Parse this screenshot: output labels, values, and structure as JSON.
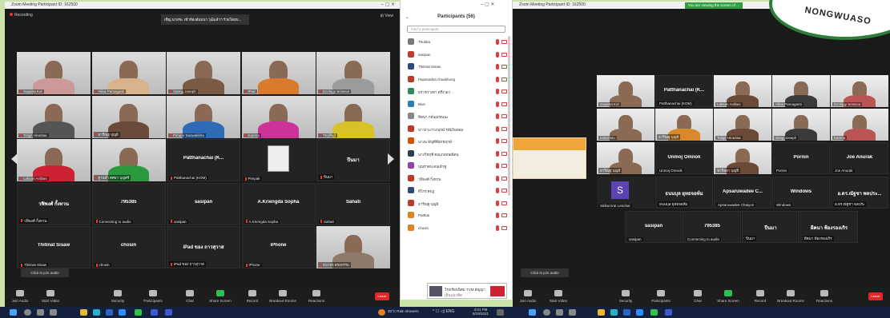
{
  "left_window": {
    "title": "Zoom Meeting Participant ID: 162500",
    "recording": "Recording",
    "view_label": "View",
    "banner": "เชิญ นายชะ เข้าห้องสัมมนา วุฒิแล้วฯ ร่วมโดยบ...",
    "tiles": [
      {
        "name": "Supatra Kol",
        "kind": "vid",
        "color": "#c99"
      },
      {
        "name": "Alina Pamaganti",
        "kind": "vid",
        "color": "#d7b28a"
      },
      {
        "name": "Saeng Joseph",
        "kind": "vid",
        "color": "#7a5a42"
      },
      {
        "name": "iPad",
        "kind": "vid",
        "color": "#d97b2a"
      },
      {
        "name": "Ecology Science",
        "kind": "vid",
        "color": "#9b9b9b"
      },
      {
        "name": "Taligit Hiranlaa",
        "kind": "vid",
        "color": "#555"
      },
      {
        "name": "ธาริณฐ บุญมี",
        "kind": "vid",
        "color": "#6a4a3a"
      },
      {
        "name": "Pimpor Saowakkha",
        "kind": "vid",
        "color": "#2e6bb5"
      },
      {
        "name": "Karima",
        "kind": "vid",
        "color": "#c39"
      },
      {
        "name": "Thylfhgf",
        "kind": "vid",
        "color": "#d9c227"
      },
      {
        "name": "Laksan Ardlani",
        "kind": "vid",
        "color": "#c23"
      },
      {
        "name": "ฐานสำ ศศธา บุญศรี",
        "kind": "vid",
        "color": "#2b9a3f"
      },
      {
        "name": "Patthanachai (K...",
        "kind": "name",
        "sub": "Patthanachai (KOM)"
      },
      {
        "name": "",
        "kind": "avatar",
        "sub": "Pimpak"
      },
      {
        "name": "ปีนมา",
        "kind": "name",
        "sub": "ปีนมา"
      },
      {
        "name": "วฟิพงศ์ กั้งทวน",
        "kind": "name",
        "sub": "วฟิพงศ์ กั้งทวน"
      },
      {
        "name": "795385",
        "kind": "name",
        "sub": "Connecting to audio"
      },
      {
        "name": "sasipan",
        "kind": "name",
        "sub": "sasipan"
      },
      {
        "name": "A.Kriengda Sopha",
        "kind": "name",
        "sub": "A.Kriengda Sopha"
      },
      {
        "name": "Sahati",
        "kind": "name",
        "sub": "Sahati"
      },
      {
        "name": "Thitinat Sisaw",
        "kind": "name",
        "sub": "Thitinat Sisaw"
      },
      {
        "name": "chosin",
        "kind": "name",
        "sub": "chosin"
      },
      {
        "name": "iPad ของ ถาวสุวาส",
        "kind": "name",
        "sub": "iPad ของ ถาวสุวาส"
      },
      {
        "name": "iPhone",
        "kind": "name",
        "sub": "iPhone"
      },
      {
        "name": "",
        "kind": "vid",
        "sub": "ธนาธร ตรงธรรม",
        "color": "#8c7a6a"
      }
    ],
    "join_audio": "Click to join audio",
    "toolbar": [
      "Join Audio",
      "Start Video",
      "Security",
      "Participants",
      "Chat",
      "Share Screen",
      "Record",
      "Breakout Rooms",
      "Reactions"
    ],
    "participants_count": "56",
    "end": "Leave"
  },
  "panel": {
    "title": "Participants (56)",
    "search_placeholder": "Find a participant",
    "rows": [
      {
        "name": "Thutiba",
        "color": "#7a7a7a"
      },
      {
        "name": "sasipan",
        "color": "#c0392b"
      },
      {
        "name": "Thitinat Sisaw",
        "color": "#2c4a7a"
      },
      {
        "name": "Papanadsa chuakhong",
        "color": "#c0392b"
      },
      {
        "name": "ธรวชว่างทา ตรึงวดา",
        "color": "#2e8b57"
      },
      {
        "name": "Bius",
        "color": "#2980b9"
      },
      {
        "name": "ทิตนา กลั่นณรณนะ",
        "color": "#7f8c8d"
      },
      {
        "name": "นาวงวะกาเงนุกษ์ รณีเงินทอม",
        "color": "#c0392b"
      },
      {
        "name": "นางน ทัญทีทีสุกชฤกษ์",
        "color": "#d35400"
      },
      {
        "name": "นางวีชฤชี คณุเกลกษณีตน",
        "color": "#2c3e50"
      },
      {
        "name": "บุณรวตน ตนเต้วซู",
        "color": "#8e44ad"
      },
      {
        "name": "วฟิพงศ์ กั้งทวน",
        "color": "#c0392b"
      },
      {
        "name": "ทิโกร ศกฏ",
        "color": "#2c4a7a"
      },
      {
        "name": "ธาริณฐ บุญมี",
        "color": "#c0392b"
      },
      {
        "name": "Patthai",
        "color": "#e67e22"
      },
      {
        "name": "chosin",
        "color": "#e67e22"
      }
    ]
  },
  "popup": {
    "text": "โรงเรียนนิคม TVM สัญญา",
    "sub": "เห็นแนวคิด"
  },
  "right_window": {
    "title": "Zoom Meeting Participant ID: 162500",
    "notice": "You are viewing the screen of ...",
    "tiles_row1": [
      "",
      "Patthanachai (K...",
      "",
      "",
      ""
    ],
    "tiles_row1_sub": [
      "Supatra Kol",
      "Patthanachai (KOM)",
      "Laksan Ardlani",
      "Alina Pamaganti",
      "Ecology Science"
    ],
    "tiles_row2_sub": [
      "Kokomsu",
      "ธาริณฐ บุญมี",
      "Taligit Hiranlaa",
      "Seng Joseph",
      "Karima"
    ],
    "tiles_row3": [
      "",
      "Unmoj Omnok",
      "",
      "Pornin",
      "Joe Anurak"
    ],
    "tiles_row3_sub": [
      "ธาริณฐ บุญมี",
      "Unmoj Omnok",
      "ชากิลยา บุญทิ",
      "Pornin",
      "Joe Anurak"
    ],
    "tiles_row4": [
      "S",
      "ธนนบุล ยุทธจอห์ม",
      "Apsaruwadee C...",
      "Windows",
      "อ.ดร.ณัฐชา พลประ..."
    ],
    "tiles_row4_sub": [
      "Sirikornrat Lenchai",
      "ธนนบุล ยุทธจอห์ม",
      "Apsaruwadee Chaiyon",
      "Windows",
      "อ.ดร.ณัฐชา พลประ"
    ],
    "tiles_row5": [
      "sasipan",
      "795385",
      "ปีนมา",
      "ผีคนา ฟ้องรองเกิร"
    ],
    "tiles_row5_sub": [
      "sasipan",
      "Connecting to audio",
      "ปีนมา",
      "ผีคนา ฟ้องรองเกิร"
    ],
    "join_audio": "Click to join audio",
    "toolbar": [
      "Join Audio",
      "Start Video",
      "Security",
      "Participants",
      "Chat",
      "Share Screen",
      "Record",
      "Breakout Rooms",
      "Reactions"
    ],
    "end": "Leave"
  },
  "taskbar": {
    "weather": "30°C Rain showers",
    "time": "4:01 PM",
    "date": "8/19/2021"
  },
  "logo_text": "NONGWUASO"
}
